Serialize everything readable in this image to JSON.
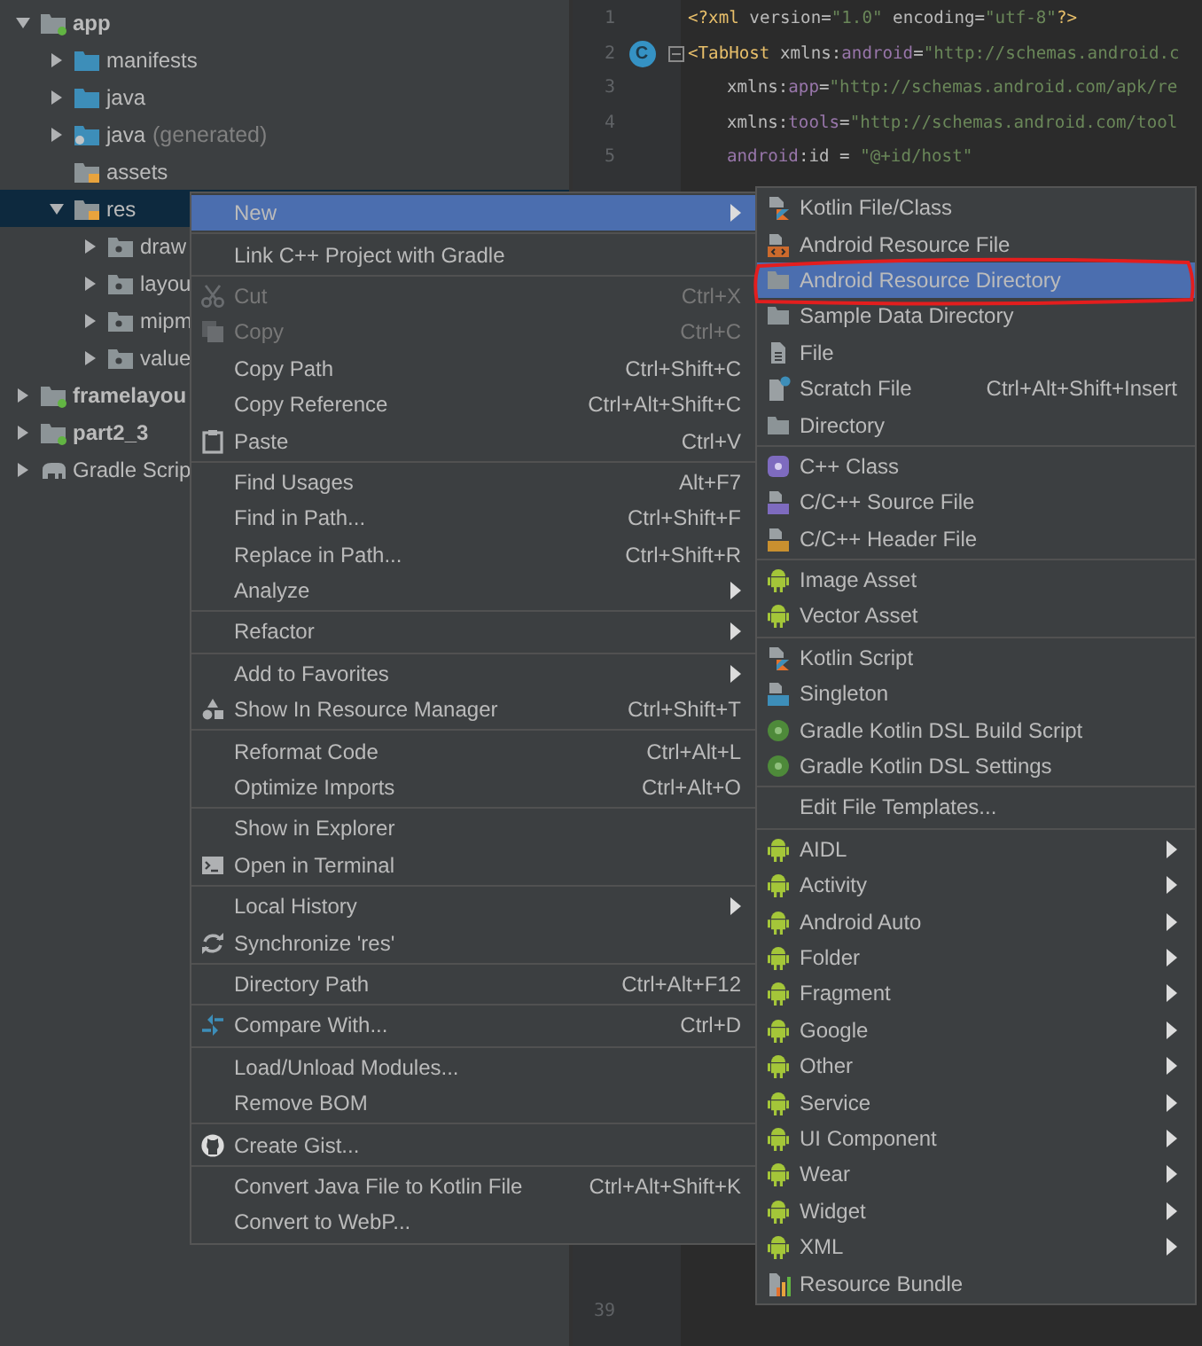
{
  "project_tree": [
    {
      "label": "app",
      "kind": "module",
      "selected": false,
      "expanded": true,
      "children": [
        {
          "label": "manifests",
          "kind": "source",
          "selected": false,
          "expanded": false
        },
        {
          "label": "java",
          "kind": "source",
          "selected": false,
          "expanded": false
        },
        {
          "label": "java",
          "suffix": "(generated)",
          "kind": "generated",
          "selected": false,
          "expanded": false
        },
        {
          "label": "assets",
          "kind": "resource",
          "selected": false
        },
        {
          "label": "res",
          "kind": "resource",
          "selected": true,
          "expanded": true,
          "children": [
            {
              "label": "draw",
              "kind": "resource-dir",
              "selected": false,
              "expanded": false
            },
            {
              "label": "layou",
              "kind": "resource-dir",
              "selected": false,
              "expanded": false
            },
            {
              "label": "mipm",
              "kind": "resource-dir",
              "selected": false,
              "expanded": false
            },
            {
              "label": "value",
              "kind": "resource-dir",
              "selected": false,
              "expanded": false
            }
          ]
        }
      ]
    },
    {
      "label": "framelayou",
      "kind": "module",
      "selected": false,
      "expanded": false
    },
    {
      "label": "part2_3",
      "kind": "module",
      "selected": false,
      "expanded": false
    },
    {
      "label": "Gradle Scrip",
      "kind": "gradle",
      "selected": false,
      "expanded": false
    }
  ],
  "editor": {
    "lines": [
      {
        "number": "1",
        "indent": false,
        "fold": false,
        "tokens": [
          {
            "kind": "tag",
            "text": "<?xml"
          },
          {
            "kind": "plain",
            "text": " version="
          },
          {
            "kind": "value",
            "text": "\"1.0\""
          },
          {
            "kind": "plain",
            "text": " encoding="
          },
          {
            "kind": "value",
            "text": "\"utf-8\""
          },
          {
            "kind": "tag",
            "text": "?>"
          }
        ]
      },
      {
        "number": "2",
        "indent": false,
        "fold": true,
        "badge": "C",
        "tokens": [
          {
            "kind": "tag",
            "text": "<TabHost"
          },
          {
            "kind": "plain",
            "text": " xmlns:"
          },
          {
            "kind": "attr",
            "text": "android"
          },
          {
            "kind": "plain",
            "text": "="
          },
          {
            "kind": "value",
            "text": "\"http://schemas.android.c"
          }
        ]
      },
      {
        "number": "3",
        "indent": true,
        "fold": false,
        "tokens": [
          {
            "kind": "plain",
            "text": "xmlns:"
          },
          {
            "kind": "attr",
            "text": "app"
          },
          {
            "kind": "plain",
            "text": "="
          },
          {
            "kind": "value",
            "text": "\"http://schemas.android.com/apk/re"
          }
        ]
      },
      {
        "number": "4",
        "indent": true,
        "fold": false,
        "tokens": [
          {
            "kind": "plain",
            "text": "xmlns:"
          },
          {
            "kind": "attr",
            "text": "tools"
          },
          {
            "kind": "plain",
            "text": "="
          },
          {
            "kind": "value",
            "text": "\"http://schemas.android.com/tool"
          }
        ]
      },
      {
        "number": "5",
        "indent": true,
        "fold": false,
        "tokens": [
          {
            "kind": "attr",
            "text": "android"
          },
          {
            "kind": "plain",
            "text": ":id = "
          },
          {
            "kind": "value",
            "text": "\"@+id/host\""
          }
        ]
      }
    ],
    "bottom_line_number": "39"
  },
  "context_menu": {
    "groups": [
      [
        {
          "label": "New",
          "submenu": true,
          "selected": true,
          "disabled": false
        }
      ],
      [
        {
          "label": "Link C++ Project with Gradle",
          "submenu": false,
          "selected": false,
          "disabled": false
        }
      ],
      [
        {
          "label": "Cut",
          "shortcut": "Ctrl+X",
          "kind": "scissors",
          "submenu": false,
          "selected": false,
          "disabled": true
        },
        {
          "label": "Copy",
          "shortcut": "Ctrl+C",
          "kind": "copy",
          "submenu": false,
          "selected": false,
          "disabled": true
        },
        {
          "label": "Copy Path",
          "shortcut": "Ctrl+Shift+C",
          "submenu": false,
          "selected": false,
          "disabled": false
        },
        {
          "label": "Copy Reference",
          "shortcut": "Ctrl+Alt+Shift+C",
          "submenu": false,
          "selected": false,
          "disabled": false
        },
        {
          "label": "Paste",
          "shortcut": "Ctrl+V",
          "kind": "clipboard",
          "submenu": false,
          "selected": false,
          "disabled": false
        }
      ],
      [
        {
          "label": "Find Usages",
          "shortcut": "Alt+F7",
          "submenu": false,
          "selected": false,
          "disabled": false
        },
        {
          "label": "Find in Path...",
          "shortcut": "Ctrl+Shift+F",
          "submenu": false,
          "selected": false,
          "disabled": false
        },
        {
          "label": "Replace in Path...",
          "shortcut": "Ctrl+Shift+R",
          "submenu": false,
          "selected": false,
          "disabled": false
        },
        {
          "label": "Analyze",
          "submenu": true,
          "selected": false,
          "disabled": false
        }
      ],
      [
        {
          "label": "Refactor",
          "submenu": true,
          "selected": false,
          "disabled": false
        }
      ],
      [
        {
          "label": "Add to Favorites",
          "submenu": true,
          "selected": false,
          "disabled": false
        },
        {
          "label": "Show In Resource Manager",
          "shortcut": "Ctrl+Shift+T",
          "kind": "shapes",
          "submenu": false,
          "selected": false,
          "disabled": false
        }
      ],
      [
        {
          "label": "Reformat Code",
          "shortcut": "Ctrl+Alt+L",
          "submenu": false,
          "selected": false,
          "disabled": false
        },
        {
          "label": "Optimize Imports",
          "shortcut": "Ctrl+Alt+O",
          "submenu": false,
          "selected": false,
          "disabled": false
        }
      ],
      [
        {
          "label": "Show in Explorer",
          "submenu": false,
          "selected": false,
          "disabled": false
        },
        {
          "label": "Open in Terminal",
          "kind": "terminal",
          "submenu": false,
          "selected": false,
          "disabled": false
        }
      ],
      [
        {
          "label": "Local History",
          "submenu": true,
          "selected": false,
          "disabled": false
        },
        {
          "label": "Synchronize 'res'",
          "kind": "sync",
          "submenu": false,
          "selected": false,
          "disabled": false
        }
      ],
      [
        {
          "label": "Directory Path",
          "shortcut": "Ctrl+Alt+F12",
          "submenu": false,
          "selected": false,
          "disabled": false
        }
      ],
      [
        {
          "label": "Compare With...",
          "shortcut": "Ctrl+D",
          "kind": "compare",
          "submenu": false,
          "selected": false,
          "disabled": false
        }
      ],
      [
        {
          "label": "Load/Unload Modules...",
          "submenu": false,
          "selected": false,
          "disabled": false
        },
        {
          "label": "Remove BOM",
          "submenu": false,
          "selected": false,
          "disabled": false
        }
      ],
      [
        {
          "label": "Create Gist...",
          "kind": "github",
          "submenu": false,
          "selected": false,
          "disabled": false
        }
      ],
      [
        {
          "label": "Convert Java File to Kotlin File",
          "shortcut": "Ctrl+Alt+Shift+K",
          "submenu": false,
          "selected": false,
          "disabled": false
        },
        {
          "label": "Convert to WebP...",
          "submenu": false,
          "selected": false,
          "disabled": false
        }
      ]
    ]
  },
  "new_submenu": {
    "groups": [
      [
        {
          "label": "Kotlin File/Class",
          "kind": "kotlin",
          "submenu": false,
          "selected": false,
          "circled": false
        },
        {
          "label": "Android Resource File",
          "kind": "resource-file",
          "submenu": false,
          "selected": false,
          "circled": false
        },
        {
          "label": "Android Resource Directory",
          "kind": "folder",
          "submenu": false,
          "selected": true,
          "circled": true
        },
        {
          "label": "Sample Data Directory",
          "kind": "folder",
          "submenu": false,
          "selected": false,
          "circled": false
        },
        {
          "label": "File",
          "kind": "file",
          "submenu": false,
          "selected": false,
          "circled": false
        },
        {
          "label": "Scratch File",
          "shortcut": "Ctrl+Alt+Shift+Insert",
          "kind": "scratch",
          "submenu": false,
          "selected": false,
          "circled": false
        },
        {
          "label": "Directory",
          "kind": "folder",
          "submenu": false,
          "selected": false,
          "circled": false
        }
      ],
      [
        {
          "label": "C++ Class",
          "kind": "cpp-class",
          "submenu": false,
          "selected": false,
          "circled": false
        },
        {
          "label": "C/C++ Source File",
          "kind": "cpp-source",
          "submenu": false,
          "selected": false,
          "circled": false
        },
        {
          "label": "C/C++ Header File",
          "kind": "cpp-header",
          "submenu": false,
          "selected": false,
          "circled": false
        }
      ],
      [
        {
          "label": "Image Asset",
          "kind": "android",
          "submenu": false,
          "selected": false,
          "circled": false
        },
        {
          "label": "Vector Asset",
          "kind": "android",
          "submenu": false,
          "selected": false,
          "circled": false
        }
      ],
      [
        {
          "label": "Kotlin Script",
          "kind": "kotlin",
          "submenu": false,
          "selected": false,
          "circled": false
        },
        {
          "label": "Singleton",
          "kind": "singleton",
          "submenu": false,
          "selected": false,
          "circled": false
        },
        {
          "label": "Gradle Kotlin DSL Build Script",
          "kind": "gradle",
          "submenu": false,
          "selected": false,
          "circled": false
        },
        {
          "label": "Gradle Kotlin DSL Settings",
          "kind": "gradle",
          "submenu": false,
          "selected": false,
          "circled": false
        }
      ],
      [
        {
          "label": "Edit File Templates...",
          "submenu": false,
          "selected": false,
          "circled": false
        }
      ],
      [
        {
          "label": "AIDL",
          "kind": "android",
          "submenu": true,
          "selected": false,
          "circled": false
        },
        {
          "label": "Activity",
          "kind": "android",
          "submenu": true,
          "selected": false,
          "circled": false
        },
        {
          "label": "Android Auto",
          "kind": "android",
          "submenu": true,
          "selected": false,
          "circled": false
        },
        {
          "label": "Folder",
          "kind": "android",
          "submenu": true,
          "selected": false,
          "circled": false
        },
        {
          "label": "Fragment",
          "kind": "android",
          "submenu": true,
          "selected": false,
          "circled": false
        },
        {
          "label": "Google",
          "kind": "android",
          "submenu": true,
          "selected": false,
          "circled": false
        },
        {
          "label": "Other",
          "kind": "android",
          "submenu": true,
          "selected": false,
          "circled": false
        },
        {
          "label": "Service",
          "kind": "android",
          "submenu": true,
          "selected": false,
          "circled": false
        },
        {
          "label": "UI Component",
          "kind": "android",
          "submenu": true,
          "selected": false,
          "circled": false
        },
        {
          "label": "Wear",
          "kind": "android",
          "submenu": true,
          "selected": false,
          "circled": false
        },
        {
          "label": "Widget",
          "kind": "android",
          "submenu": true,
          "selected": false,
          "circled": false
        },
        {
          "label": "XML",
          "kind": "android",
          "submenu": true,
          "selected": false,
          "circled": false
        },
        {
          "label": "Resource Bundle",
          "kind": "bundle",
          "submenu": false,
          "selected": false,
          "circled": false
        }
      ]
    ]
  }
}
